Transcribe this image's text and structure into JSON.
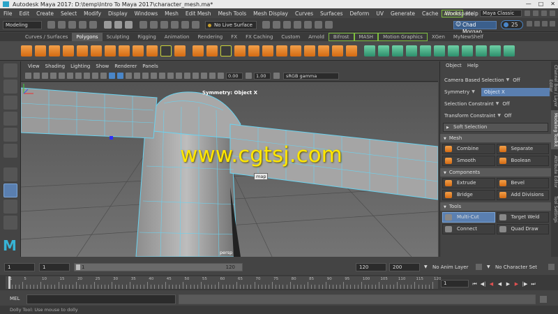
{
  "window": {
    "title": "Autodesk Maya 2017: D:\\temp\\Intro To Maya 2017\\character_mesh.ma*"
  },
  "menu": {
    "items": [
      "File",
      "Edit",
      "Create",
      "Select",
      "Modify",
      "Display",
      "Windows",
      "Mesh",
      "Edit Mesh",
      "Mesh Tools",
      "Mesh Display",
      "Curves",
      "Surfaces",
      "Deform",
      "UV",
      "Generate",
      "Cache"
    ],
    "highlight": "Arnold",
    "help": "Help",
    "workspace_label": "Workspace :",
    "workspace_value": "Maya Classic"
  },
  "status": {
    "mode": "Modeling",
    "live_surface": "No Live Surface",
    "user": "Chad Morgan",
    "count": "25"
  },
  "shelf_tabs": [
    {
      "label": "Curves / Surfaces",
      "active": false,
      "hl": false
    },
    {
      "label": "Polygons",
      "active": true,
      "hl": false
    },
    {
      "label": "Sculpting",
      "active": false,
      "hl": false
    },
    {
      "label": "Rigging",
      "active": false,
      "hl": false
    },
    {
      "label": "Animation",
      "active": false,
      "hl": false
    },
    {
      "label": "Rendering",
      "active": false,
      "hl": false
    },
    {
      "label": "FX",
      "active": false,
      "hl": false
    },
    {
      "label": "FX Caching",
      "active": false,
      "hl": false
    },
    {
      "label": "Custom",
      "active": false,
      "hl": false
    },
    {
      "label": "Arnold",
      "active": false,
      "hl": false
    },
    {
      "label": "Bifrost",
      "active": false,
      "hl": true
    },
    {
      "label": "MASH",
      "active": false,
      "hl": true
    },
    {
      "label": "Motion Graphics",
      "active": false,
      "hl": true
    },
    {
      "label": "XGen",
      "active": false,
      "hl": false
    },
    {
      "label": "MyNewShelf",
      "active": false,
      "hl": false
    }
  ],
  "viewport": {
    "menu": [
      "View",
      "Shading",
      "Lighting",
      "Show",
      "Renderer",
      "Panels"
    ],
    "field1": "0.00",
    "field2": "1.00",
    "gamma": "sRGB gamma",
    "symmetry_label": "Symmetry: Object X",
    "camera_label": "persp",
    "watermark": "www.cgtsj.com",
    "cursor_label": "map"
  },
  "right_panel": {
    "header": [
      "Object",
      "Help"
    ],
    "camera_based_selection": "Camera Based Selection",
    "camera_based_value": "Off",
    "symmetry": "Symmetry",
    "symmetry_value": "Object X",
    "selection_constraint": "Selection Constraint",
    "selection_constraint_value": "Off",
    "transform_constraint": "Transform Constraint",
    "transform_constraint_value": "Off",
    "soft_selection": "Soft Selection",
    "sections": {
      "mesh": "Mesh",
      "components": "Components",
      "tools": "Tools"
    },
    "mesh_buttons": [
      "Combine",
      "Separate",
      "Smooth",
      "Boolean"
    ],
    "component_buttons": [
      "Extrude",
      "Bevel",
      "Bridge",
      "Add Divisions"
    ],
    "tool_buttons": [
      "Multi-Cut",
      "Target Weld",
      "Connect",
      "Quad Draw"
    ]
  },
  "side_tabs": [
    "Channel Box / Layer Editor",
    "Modeling Toolkit",
    "Attribute Editor",
    "Tool Settings"
  ],
  "range": {
    "start": "1",
    "start2": "1",
    "slider_left": "1",
    "slider_right": "120",
    "end": "120",
    "end2": "200",
    "anim_layer": "No Anim Layer",
    "char_set": "No Character Set"
  },
  "timeline": {
    "ticks": [
      "1",
      "5",
      "10",
      "15",
      "20",
      "25",
      "30",
      "35",
      "40",
      "45",
      "50",
      "55",
      "60",
      "65",
      "70",
      "75",
      "80",
      "85",
      "90",
      "95",
      "100",
      "105",
      "110",
      "115",
      "120"
    ],
    "current_frame": "1"
  },
  "cmd": {
    "label": "MEL"
  },
  "help_line": "Dolly Tool: Use mouse to dolly"
}
